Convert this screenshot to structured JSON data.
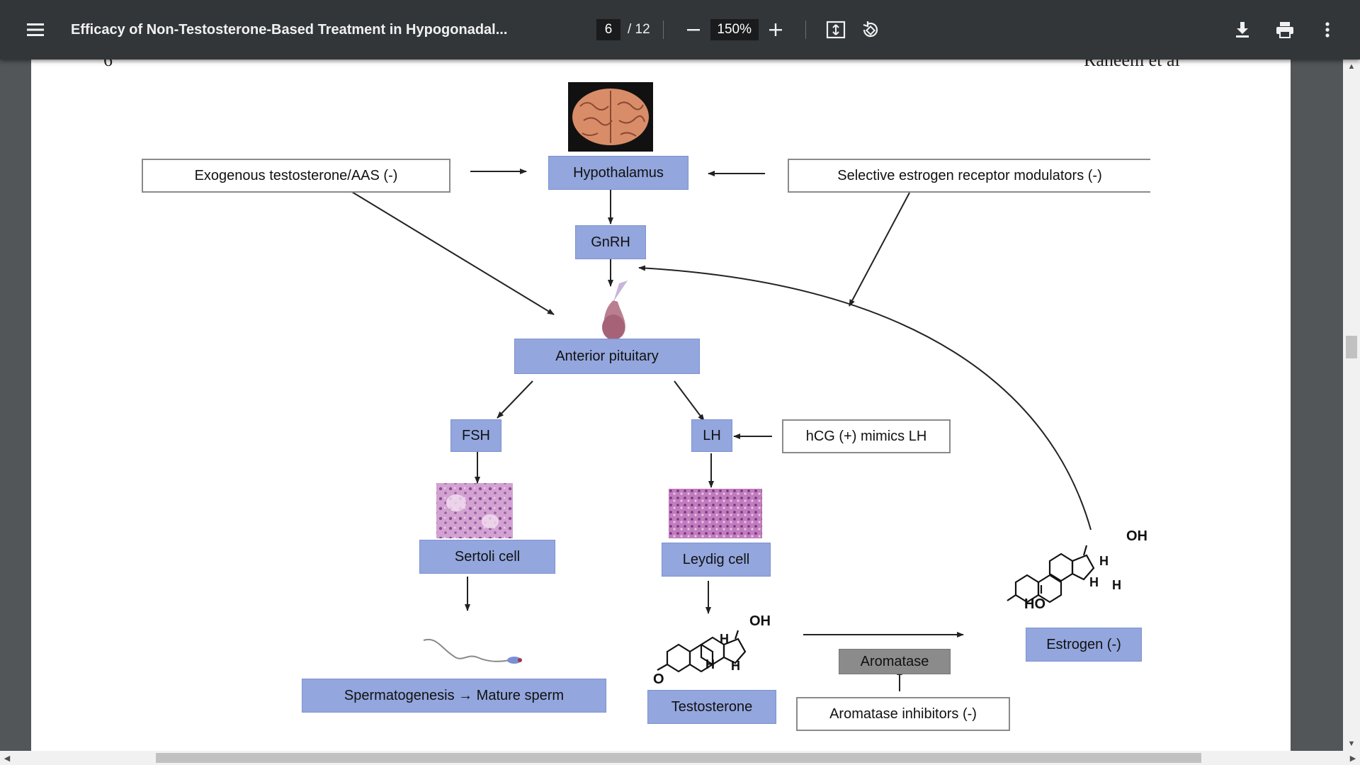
{
  "toolbar": {
    "title": "Efficacy of Non-Testosterone-Based Treatment in Hypogonadal...",
    "page_current": "6",
    "page_total": "/ 12",
    "zoom": "150%"
  },
  "page_header": {
    "left": "6",
    "right": "Raheem et al"
  },
  "diagram": {
    "exogenous": "Exogenous testosterone/AAS (-)",
    "hypothalamus": "Hypothalamus",
    "serm": "Selective estrogen receptor modulators (-)",
    "gnrh": "GnRH",
    "anterior_pituitary": "Anterior pituitary",
    "fsh": "FSH",
    "lh": "LH",
    "hcg": "hCG (+) mimics LH",
    "sertoli": "Sertoli cell",
    "leydig": "Leydig cell",
    "spermatogenesis": "Spermatogenesis → Mature sperm",
    "testosterone": "Testosterone",
    "aromatase": "Aromatase",
    "aromatase_inhibitors": "Aromatase inhibitors (-)",
    "estrogen": "Estrogen (-)",
    "chem": {
      "oh1": "OH",
      "h1": "H",
      "h2": "H",
      "h3": "H",
      "o": "O",
      "oh2": "OH",
      "h4": "H",
      "h5": "H",
      "h6": "H",
      "ho": "HO"
    }
  },
  "icons": [
    "menu-icon",
    "minus-icon",
    "plus-icon",
    "fit-page-icon",
    "rotate-icon",
    "download-icon",
    "print-icon",
    "more-vert-icon"
  ]
}
